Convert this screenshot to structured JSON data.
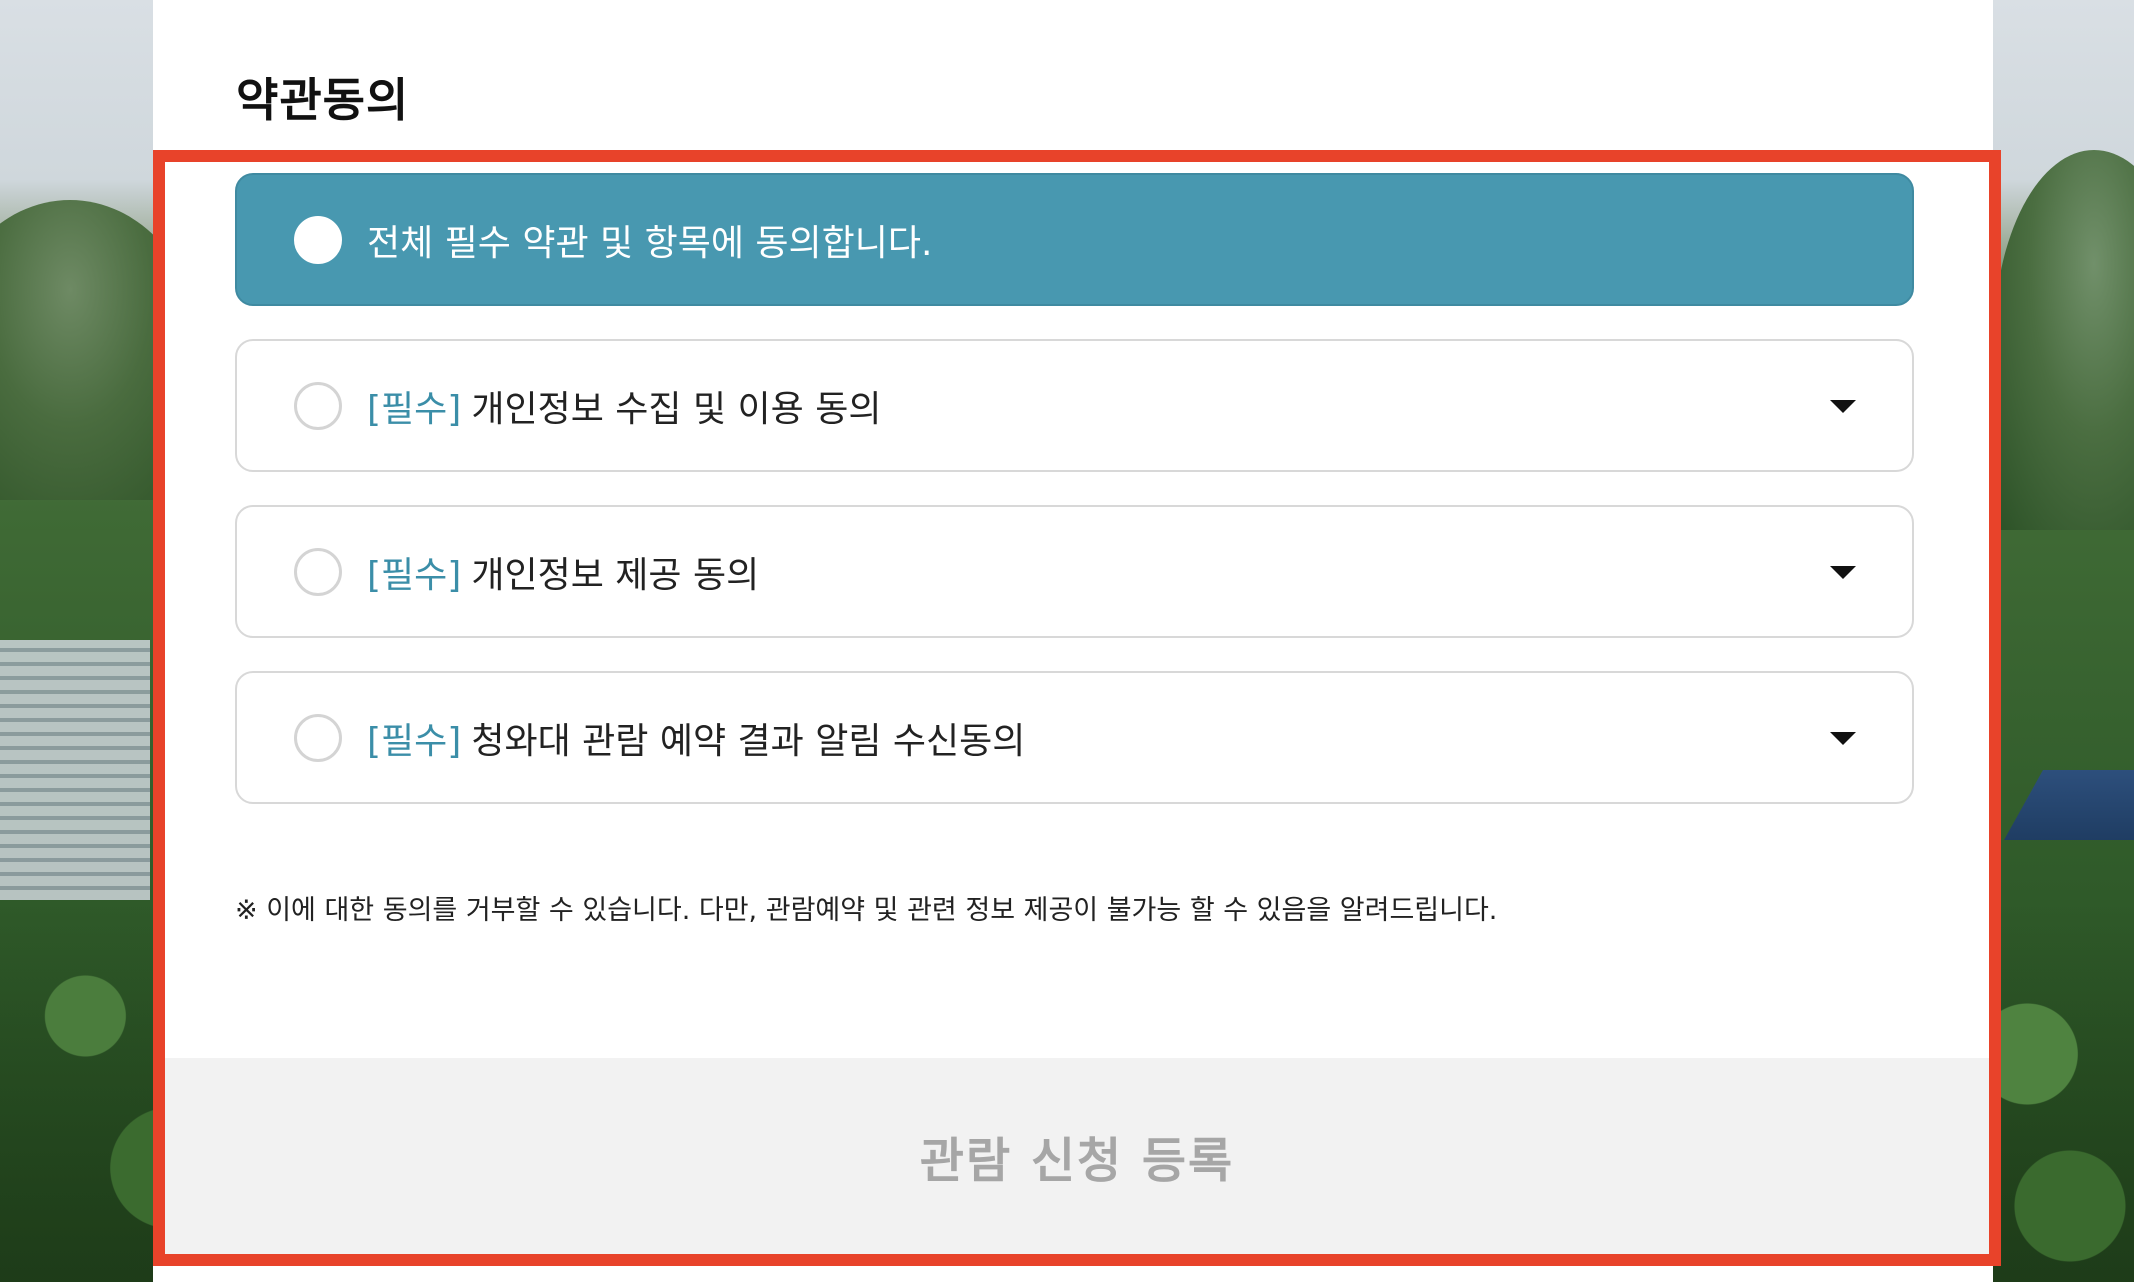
{
  "section": {
    "title": "약관동의"
  },
  "agree_all": {
    "label": "전체 필수 약관 및 항목에 동의합니다."
  },
  "agreements": [
    {
      "tag": "[필수]",
      "label": "개인정보 수집 및 이용 동의",
      "icon": "chevron-down-icon"
    },
    {
      "tag": "[필수]",
      "label": "개인정보 제공 동의",
      "icon": "chevron-down-icon"
    },
    {
      "tag": "[필수]",
      "label": "청와대 관람 예약 결과 알림 수신동의",
      "icon": "chevron-down-icon"
    }
  ],
  "notice": "※ 이에 대한 동의를 거부할 수 있습니다. 다만, 관람예약 및 관련 정보 제공이 불가능 할 수 있음을 알려드립니다.",
  "submit": {
    "label": "관람 신청 등록"
  },
  "colors": {
    "accent": "#4898b0",
    "tag": "#3b8ea8",
    "highlight_frame": "#e8432a",
    "submit_bg": "#f2f2f2",
    "submit_text": "#a6a6a6"
  }
}
